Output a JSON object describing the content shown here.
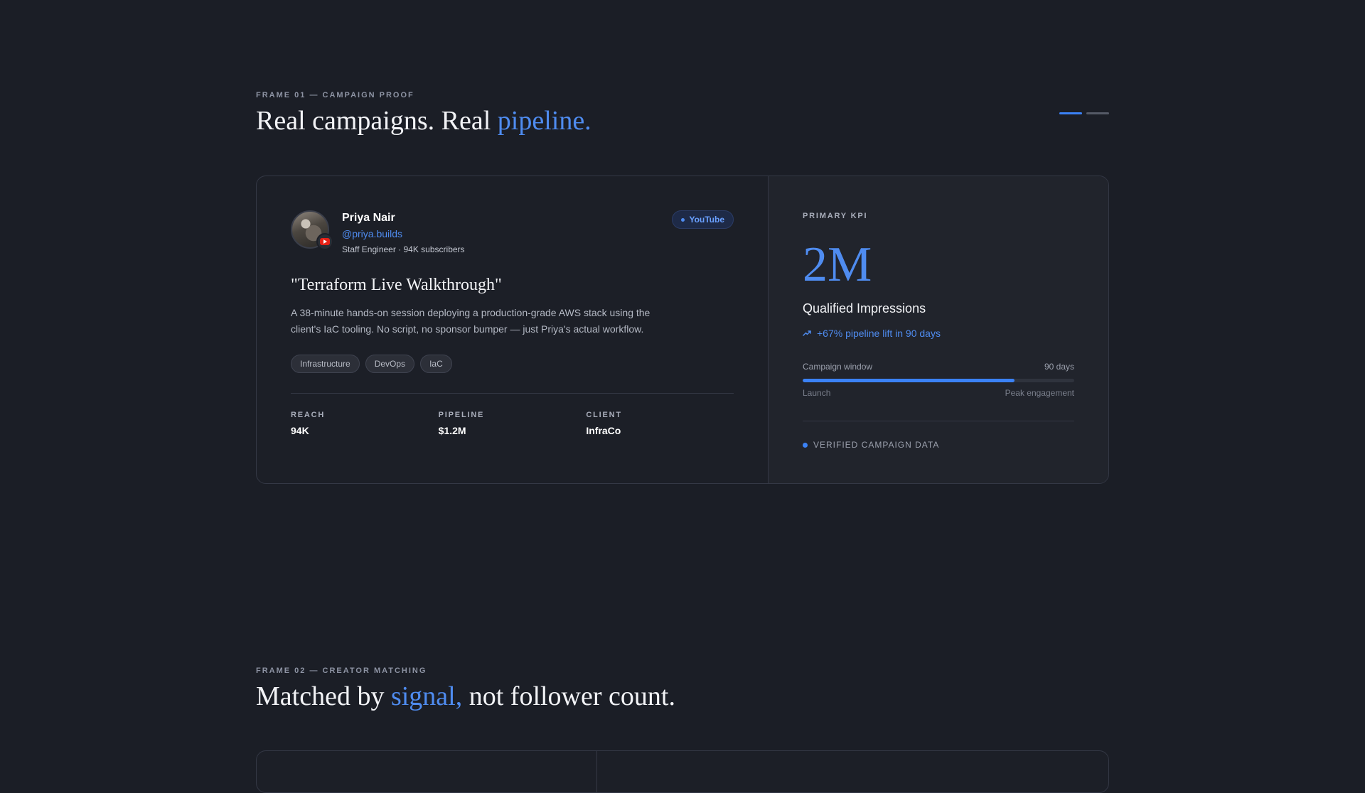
{
  "frame1": {
    "eyebrow": "FRAME 01 — CAMPAIGN PROOF",
    "headline_plain": "Real campaigns. Real ",
    "headline_accent": "pipeline.",
    "pager": {
      "total": 2,
      "active_index": 0
    }
  },
  "creator": {
    "name": "Priya Nair",
    "handle": "@priya.builds",
    "meta": "Staff Engineer · 94K subscribers",
    "platform": "YouTube",
    "avatar_badge_icon": "youtube-icon"
  },
  "campaign": {
    "title": "\"Terraform Live Walkthrough\"",
    "description": "A 38-minute hands-on session deploying a production-grade AWS stack using the client's IaC tooling. No script, no sponsor bumper — just Priya's actual workflow.",
    "tags": [
      "Infrastructure",
      "DevOps",
      "IaC"
    ]
  },
  "stats": [
    {
      "label": "REACH",
      "value": "94K"
    },
    {
      "label": "PIPELINE",
      "value": "$1.2M"
    },
    {
      "label": "CLIENT",
      "value": "InfraCo"
    }
  ],
  "kpi": {
    "label": "PRIMARY KPI",
    "value": "2M",
    "caption": "Qualified Impressions",
    "lift": "+67% pipeline lift in 90 days",
    "lift_icon": "trending-up-icon",
    "window_label": "Campaign window",
    "window_value": "90 days",
    "window_progress": 0.78,
    "range_start": "Launch",
    "range_end": "Peak engagement",
    "verified": "VERIFIED CAMPAIGN DATA"
  },
  "frame2": {
    "eyebrow": "FRAME 02 — CREATOR MATCHING",
    "headline_pre": "Matched by ",
    "headline_accent": "signal,",
    "headline_post": " not follower count."
  },
  "colors": {
    "background": "#1b1e26",
    "accent": "#4f8cf0",
    "youtube_red": "#e62117"
  }
}
